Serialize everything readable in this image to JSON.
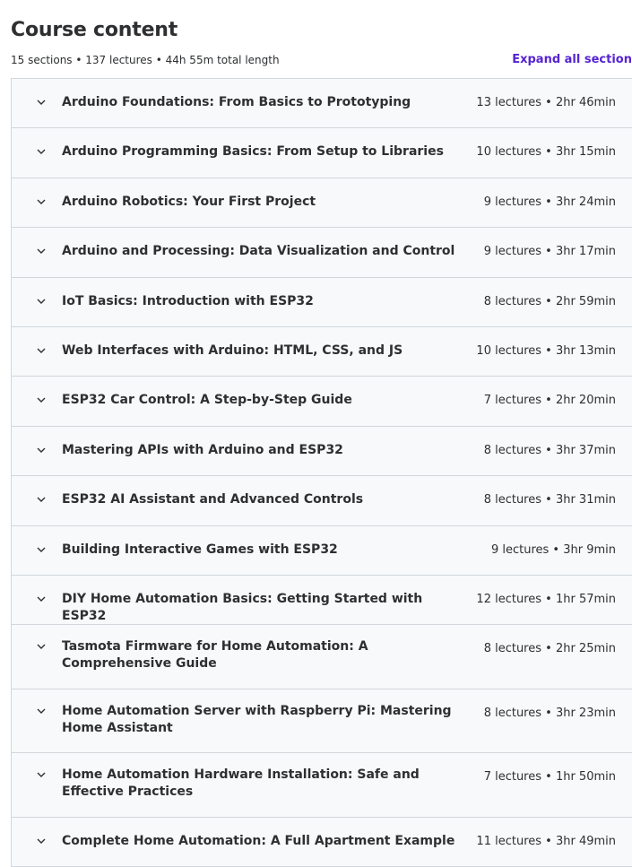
{
  "header": {
    "title": "Course content",
    "summary": "15 sections • 137 lectures • 44h 55m total length",
    "expand_label": "Expand all section"
  },
  "icons": {
    "chevron": "chevron-down-icon"
  },
  "colors": {
    "link": "#5624d0",
    "section_bg": "#f7f9fa",
    "border": "#d1d7dc",
    "text": "#2d2f31"
  },
  "sections": [
    {
      "title": "Arduino Foundations: From Basics to Prototyping",
      "meta": "13 lectures • 2hr 46min"
    },
    {
      "title": "Arduino Programming Basics: From Setup to Libraries",
      "meta": "10 lectures • 3hr 15min"
    },
    {
      "title": "Arduino Robotics: Your First Project",
      "meta": "9 lectures • 3hr 24min"
    },
    {
      "title": "Arduino and Processing: Data Visualization and Control",
      "meta": "9 lectures • 3hr 17min"
    },
    {
      "title": "IoT Basics: Introduction with ESP32",
      "meta": "8 lectures • 2hr 59min"
    },
    {
      "title": "Web Interfaces with Arduino: HTML, CSS, and JS",
      "meta": "10 lectures • 3hr 13min"
    },
    {
      "title": "ESP32 Car Control: A Step-by-Step Guide",
      "meta": "7 lectures • 2hr 20min"
    },
    {
      "title": "Mastering APIs with Arduino and ESP32",
      "meta": "8 lectures • 3hr 37min"
    },
    {
      "title": "ESP32 AI Assistant and Advanced Controls",
      "meta": "8 lectures • 3hr 31min"
    },
    {
      "title": "Building Interactive Games with ESP32",
      "meta": "9 lectures • 3hr 9min"
    },
    {
      "title": "DIY Home Automation Basics: Getting Started with ESP32",
      "meta": "12 lectures • 1hr 57min"
    },
    {
      "title": "Tasmota Firmware for Home Automation: A Comprehensive Guide",
      "meta": "8 lectures • 2hr 25min"
    },
    {
      "title": "Home Automation Server with Raspberry Pi: Mastering Home Assistant",
      "meta": "8 lectures • 3hr 23min"
    },
    {
      "title": "Home Automation Hardware Installation: Safe and Effective Practices",
      "meta": "7 lectures • 1hr 50min"
    },
    {
      "title": "Complete Home Automation: A Full Apartment Example",
      "meta": "11 lectures • 3hr 49min"
    }
  ]
}
